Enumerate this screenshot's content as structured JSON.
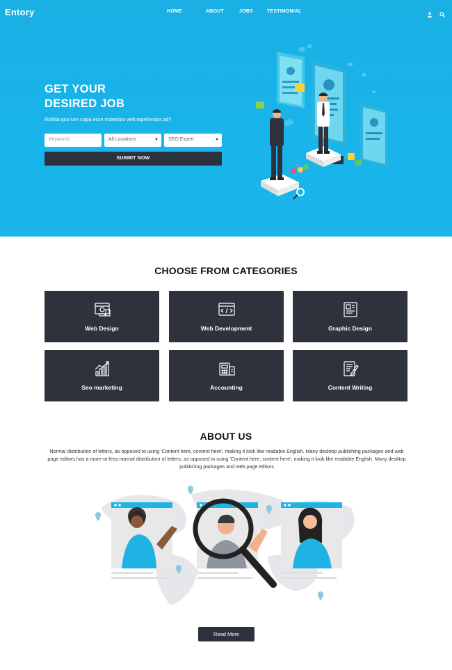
{
  "brand": {
    "logo": "Entory"
  },
  "nav": {
    "items": [
      {
        "label": "HOME"
      },
      {
        "label": "ABOUT"
      },
      {
        "label": "JOBS"
      },
      {
        "label": "TESTIMONIAL"
      }
    ],
    "icons": [
      "user-icon",
      "search-icon"
    ]
  },
  "hero": {
    "title_line1": "GET YOUR",
    "title_line2": "DESIRED JOB",
    "subtitle": "Mollitia quo iure culpa esse molestias velit repellendus ad?",
    "keywords_placeholder": "Keywords",
    "location_value": "All Locations",
    "category_value": "SEO Expert",
    "submit_label": "SUBMIT NOW"
  },
  "categories": {
    "title": "CHOOSE FROM CATEGORIES",
    "items": [
      {
        "label": "Web Design",
        "icon": "web-design-icon"
      },
      {
        "label": "Web Development",
        "icon": "web-development-icon"
      },
      {
        "label": "Graphic Design",
        "icon": "graphic-design-icon"
      },
      {
        "label": "Seo marketing",
        "icon": "seo-chart-icon"
      },
      {
        "label": "Accounting",
        "icon": "calculator-icon"
      },
      {
        "label": "Content Writing",
        "icon": "document-pen-icon"
      }
    ]
  },
  "about": {
    "title": "ABOUT US",
    "text": "Normal distribution of letters, as opposed to using 'Content here, content here', making it look like readable English. Many desktop publishing packages and web page editors has a more-or-less normal distribution of letters, as opposed to using 'Content here, content here', making it look like readable English. Many desktop publishing packages and web page editors",
    "button_label": "Read More"
  },
  "colors": {
    "hero_bg": "#19b3e8",
    "dark": "#2d323d",
    "accent": "#1ab2e6"
  }
}
